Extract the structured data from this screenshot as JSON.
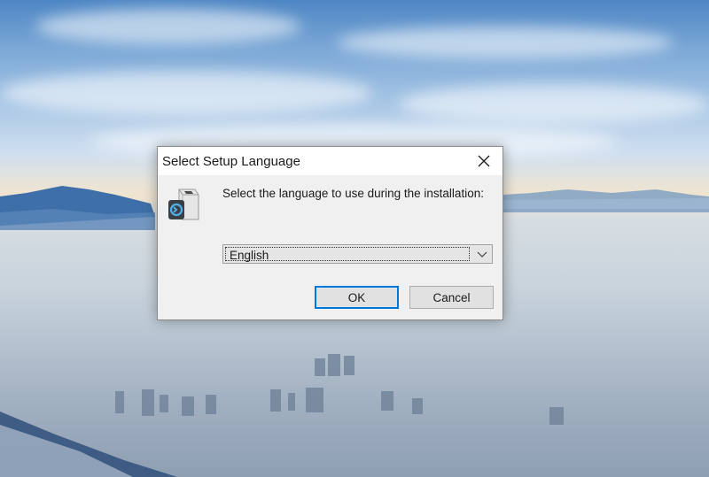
{
  "dialog": {
    "title": "Select Setup Language",
    "prompt": "Select the language to use during the installation:",
    "language_select": {
      "selected": "English"
    },
    "buttons": {
      "ok_label": "OK",
      "cancel_label": "Cancel"
    },
    "icons": {
      "close": "close-icon",
      "setup": "setup-package-icon",
      "dropdown": "chevron-down-icon"
    }
  },
  "colors": {
    "default_button_border": "#0078d7",
    "dialog_background": "#f0f0f0",
    "titlebar_background": "#ffffff"
  }
}
